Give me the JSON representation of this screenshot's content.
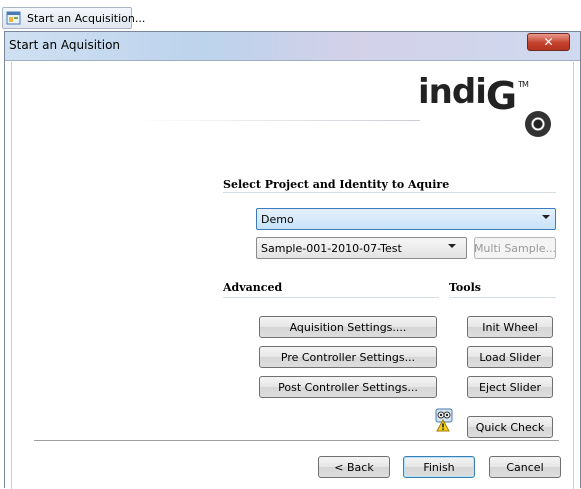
{
  "taskbar": {
    "label": "Start an Acquisition..."
  },
  "window": {
    "title": "Start an Aquisition"
  },
  "logo": {
    "text_main": "indi",
    "text_g": "G",
    "tm": "TM"
  },
  "project_section": {
    "title": "Select Project and Identity to Aquire",
    "project_value": "Demo",
    "identity_value": "Sample-001-2010-07-Test",
    "multi_sample_label": "Multi Sample..."
  },
  "advanced_section": {
    "title": "Advanced",
    "buttons": [
      "Aquisition Settings....",
      "Pre Controller Settings...",
      "Post Controller Settings..."
    ]
  },
  "tools_section": {
    "title": "Tools",
    "buttons": [
      "Init Wheel",
      "Load Slider",
      "Eject Slider"
    ]
  },
  "quick_check_label": "Quick Check",
  "footer": {
    "back_label": "< Back",
    "finish_label": "Finish",
    "cancel_label": "Cancel"
  },
  "colors": {
    "title_gradient_start": "#cfe0f2",
    "close_red": "#c5422d",
    "combo_selected": "#cfe6fb"
  }
}
